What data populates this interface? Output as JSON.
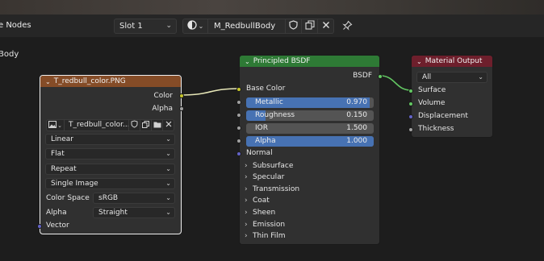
{
  "header": {
    "editor_title": "e Nodes",
    "slot": "Slot 1",
    "material_name": "M_RedbullBody",
    "icons": [
      "material-sphere-icon",
      "fake-user-shield-icon",
      "duplicate-icon",
      "unlink-x-icon",
      "pin-icon"
    ]
  },
  "canvas": {
    "breadcrumb_fragment": "Body"
  },
  "image_node": {
    "title": "T_redbull_color.PNG",
    "outputs": [
      "Color",
      "Alpha"
    ],
    "image_name": "T_redbull_color....",
    "interpolation": "Linear",
    "projection": "Flat",
    "extension": "Repeat",
    "source": "Single Image",
    "color_space_label": "Color Space",
    "color_space": "sRGB",
    "alpha_label": "Alpha",
    "alpha_mode": "Straight",
    "input_vector": "Vector",
    "header_color": "#854c27"
  },
  "bsdf_node": {
    "title": "Principled BSDF",
    "output": "BSDF",
    "base_color": "Base Color",
    "sliders": [
      {
        "label": "Metallic",
        "value": "0.970",
        "fraction": 0.97,
        "highlight": true
      },
      {
        "label": "Roughness",
        "value": "0.150",
        "fraction": 0.15,
        "highlight": false
      },
      {
        "label": "IOR",
        "value": "1.500",
        "fraction": 0.0,
        "highlight": false
      },
      {
        "label": "Alpha",
        "value": "1.000",
        "fraction": 1.0,
        "highlight": true
      }
    ],
    "normal": "Normal",
    "panels": [
      "Subsurface",
      "Specular",
      "Transmission",
      "Coat",
      "Sheen",
      "Emission",
      "Thin Film"
    ],
    "header_color": "#2e7a35"
  },
  "output_node": {
    "title": "Material Output",
    "target": "All",
    "inputs": [
      "Surface",
      "Volume",
      "Displacement",
      "Thickness"
    ],
    "header_color": "#6e1f2c"
  },
  "colors": {
    "color_socket": "#c7c729",
    "gray_socket": "#a1a1a1",
    "shader_socket": "#63c763",
    "vector_socket": "#6363c7",
    "accent": "#4772b3"
  }
}
